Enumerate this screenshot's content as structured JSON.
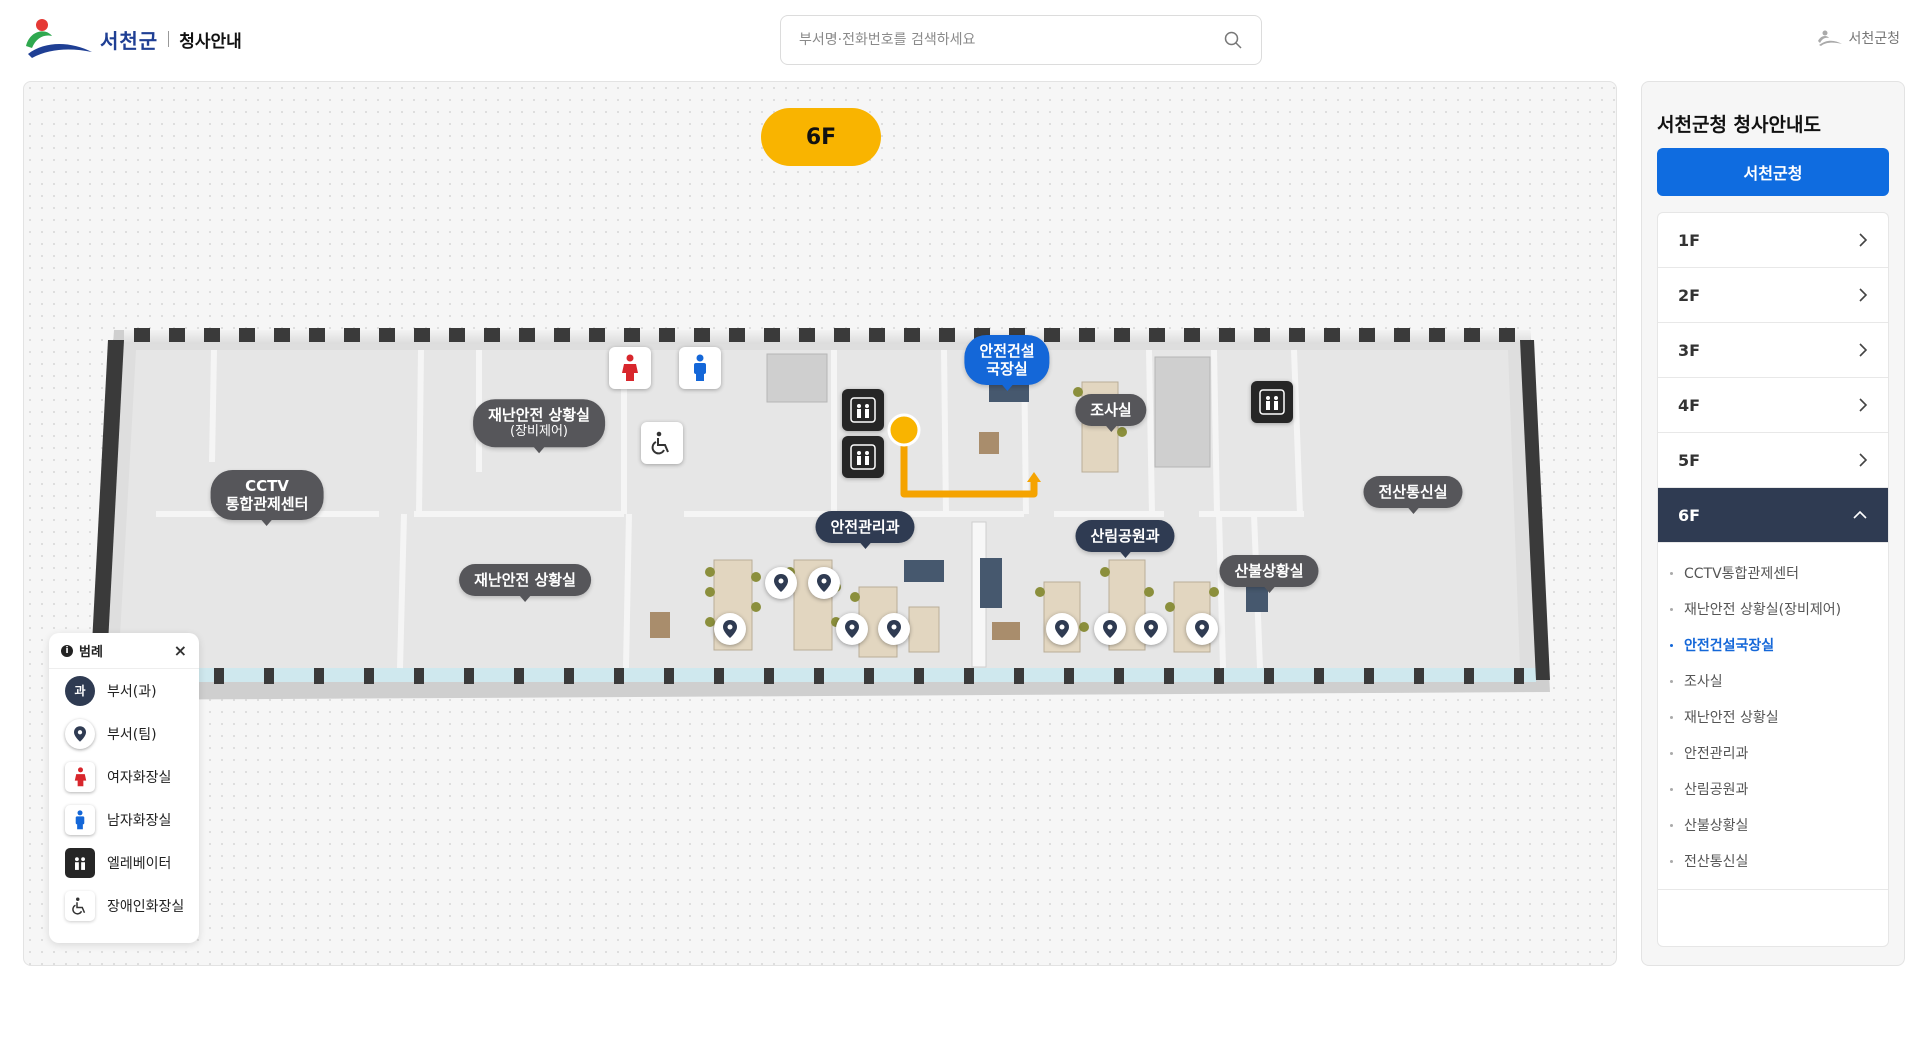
{
  "header": {
    "logo_name": "서천군",
    "logo_sub": "청사안내",
    "search_placeholder": "부서명·전화번호를 검색하세요",
    "home_link": "서천군청"
  },
  "map": {
    "floor_badge": "6F",
    "labels": {
      "cctv_line1": "CCTV",
      "cctv_line2": "통합관제센터",
      "disaster_equip_line1": "재난안전 상황실",
      "disaster_equip_line2": "(장비제어)",
      "disaster": "재난안전 상황실",
      "director_line1": "안전건설",
      "director_line2": "국장실",
      "investigation": "조사실",
      "safety": "안전관리과",
      "forest": "산림공원과",
      "fire": "산불상황실",
      "it": "전산통신실"
    }
  },
  "legend": {
    "title": "범례",
    "close": "×",
    "dept_badge": "과",
    "items": [
      "부서(과)",
      "부서(팀)",
      "여자화장실",
      "남자화장실",
      "엘레베이터",
      "장애인화장실"
    ]
  },
  "sidebar": {
    "title": "서천군청 청사안내도",
    "building_button": "서천군청",
    "floors": [
      "1F",
      "2F",
      "3F",
      "4F",
      "5F",
      "6F"
    ],
    "open_floor": "6F",
    "rooms": [
      "CCTV통합관제센터",
      "재난안전 상황실(장비제어)",
      "안전건설국장실",
      "조사실",
      "재난안전 상황실",
      "안전관리과",
      "산림공원과",
      "산불상황실",
      "전산통신실"
    ],
    "active_room": "안전건설국장실"
  },
  "colors": {
    "brand_blue": "#0f6ce0",
    "dark_navy": "#2f3b52",
    "badge_yellow": "#f9b400",
    "route_orange": "#f5a300",
    "women_red": "#d8262c",
    "men_blue": "#1467d8"
  },
  "icons": {
    "search": "search-icon",
    "close": "close-icon",
    "chevron": "chevron-right-icon",
    "pin": "location-pin-icon",
    "elevator": "elevator-icon",
    "wheelchair": "wheelchair-icon"
  }
}
